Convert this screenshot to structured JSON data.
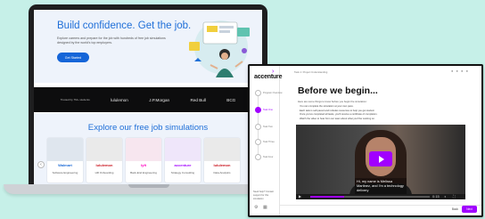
{
  "laptop": {
    "hero": {
      "title": "Build confidence. Get the job.",
      "subtitle": "Explore careers and prepare for the job with hundreds of free job simulations designed by the world's top employers.",
      "cta": "Get Started"
    },
    "logos": {
      "caption": "Trusted by 7M+ students",
      "items": [
        "lululemon",
        "J.P.Morgan",
        "Red Bull",
        "BCG"
      ]
    },
    "explore": {
      "title": "Explore our free job simulations",
      "cards": [
        {
          "brand": "Walmart",
          "category": "Software Engineering",
          "bg": "#dfe6ee",
          "color": "#1d6bd6"
        },
        {
          "brand": "lululemon",
          "category": "HR Onboarding",
          "bg": "#eaeaea",
          "color": "#c9151e"
        },
        {
          "brand": "lyft",
          "category": "Back-End Engineering",
          "bg": "#f7e6ef",
          "color": "#ff00bf"
        },
        {
          "brand": "accenture",
          "category": "Strategy Consulting",
          "bg": "#efe6fa",
          "color": "#a100ff"
        },
        {
          "brand": "lululemon",
          "category": "Data Analytics",
          "bg": "#eaeaea",
          "color": "#c9151e"
        }
      ],
      "prev_arrow": "‹",
      "next_arrow": "›"
    }
  },
  "window": {
    "logo": "accenture",
    "logo_mark": "›",
    "breadcrumb": "Task 1: Project Understanding",
    "steps": [
      {
        "label": "Program Overview",
        "active": false
      },
      {
        "label": "Task One",
        "active": true
      },
      {
        "label": "Task Two",
        "active": false
      },
      {
        "label": "Task Three",
        "active": false
      },
      {
        "label": "Task Four",
        "active": false
      }
    ],
    "side_footer": "Need help? Contact support for this simulation",
    "title": "Before we begin...",
    "intro": "Here are some things to know before you begin the simulation:",
    "bullets": [
      "You can complete the simulation at your own pace.",
      "Each task is self-paced and includes resources to help you get started.",
      "Once you've completed all tasks, you'll receive a certificate of completion.",
      "Watch the video to hear from our team about what you'll be working on."
    ],
    "video": {
      "caption": "Hi, my name is Melissa Martinez, and I'm a technology delivery",
      "time": "0:15"
    },
    "back": "Back",
    "next": "Next"
  },
  "colors": {
    "accent": "#a100ff",
    "brand_blue": "#1f6fd8",
    "background": "#c6f0e8"
  }
}
